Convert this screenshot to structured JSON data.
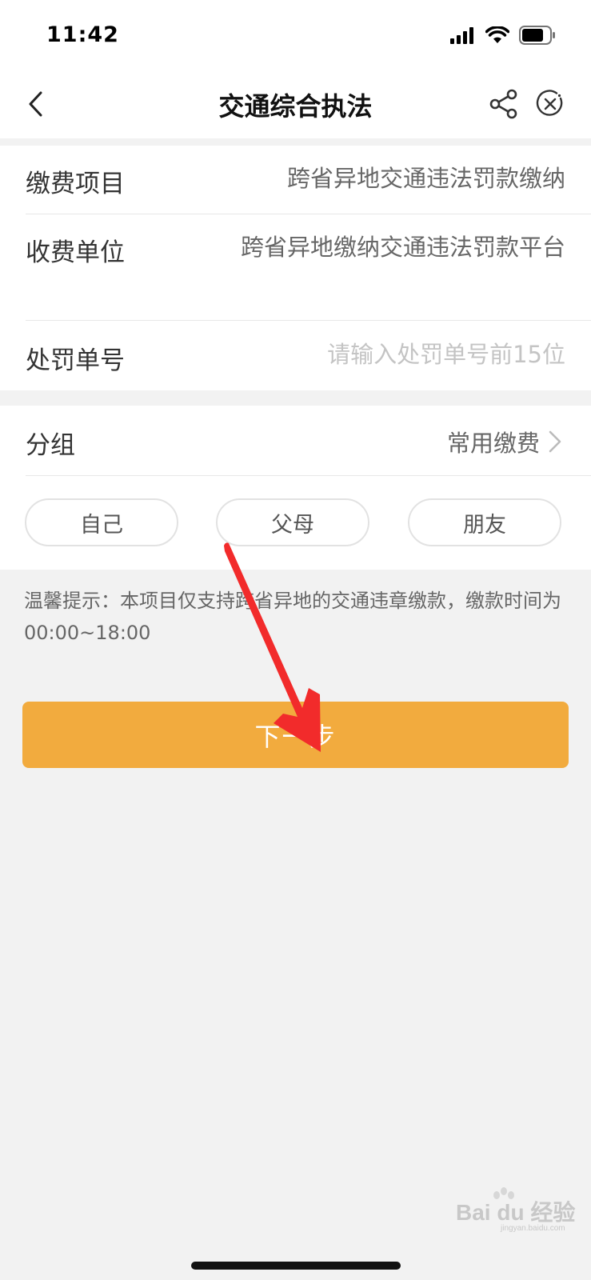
{
  "status_bar": {
    "time": "11:42",
    "icons": [
      "cellular-signal-icon",
      "wifi-icon",
      "battery-icon"
    ]
  },
  "nav": {
    "title": "交通综合执法",
    "icons": [
      "back-icon",
      "share-icon",
      "close-icon"
    ]
  },
  "form": {
    "item_label": "缴费项目",
    "item_value": "跨省异地交通违法罚款缴纳",
    "payee_label": "收费单位",
    "payee_value": "跨省异地缴纳交通违法罚款平台",
    "penalty_no_label": "处罚单号",
    "penalty_no_placeholder": "请输入处罚单号前15位",
    "penalty_no_value": ""
  },
  "group": {
    "label": "分组",
    "value": "常用缴费",
    "chips": [
      "自己",
      "父母",
      "朋友"
    ]
  },
  "tip": "温馨提示：本项目仅支持跨省异地的交通违章缴款，缴款时间为00:00~18:00",
  "next_button": "下一步",
  "colors": {
    "accent": "#f2ab3e",
    "annotation_arrow": "#f22b2b",
    "background": "#f2f2f2"
  },
  "watermark": {
    "text": "Bai du 经验",
    "sub": "jingyan.baidu.com"
  }
}
